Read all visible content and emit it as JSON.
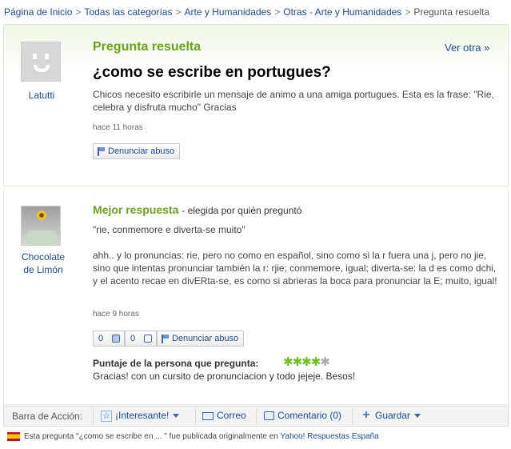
{
  "breadcrumb": {
    "items": [
      "Página de Inicio",
      "Todas las categorías",
      "Arte y Humanidades",
      "Otras - Arte y Humanidades"
    ],
    "separator": ">",
    "current": "Pregunta resuelta"
  },
  "question": {
    "status": "Pregunta resuelta",
    "ver_otra": "Ver otra »",
    "title": "¿como se escribe en portugues?",
    "body": "Chicos necesito escribirle un mensaje de animo a una amiga portugues. Esta es la frase: \"Rie, celebra y disfruta mucho\" Gracias",
    "time": "hace 11 horas",
    "report_label": "Denunciar abuso",
    "user": "Latutti"
  },
  "answer": {
    "title": "Mejor respuesta",
    "chosen_by": "- elegida por quién preguntó",
    "quote": "\"rie, conmemore e diverta-se muito\"",
    "body": "ahh.. y lo pronuncias: rie, pero no como en español, sino como si la r fuera una j, pero no jie, sino que intentas pronunciar también la r: rjie; conmemore, igual; diverta-se: la d es como dchi, y el acento recae en divERta-se, es como si abrieras la boca para pronunciar la E; muito, igual!",
    "time": "hace 9 horas",
    "thumbs_up": "0",
    "thumbs_down": "0",
    "report_label": "Denunciar abuso",
    "user_line1": "Chocolate",
    "user_line2": "de Limón"
  },
  "rating": {
    "label": "Puntaje de la persona que pregunta:",
    "stars": 4,
    "max": 5,
    "comment": "Gracias! con un cursito de pronunciacion y todo jejeje. Besos!"
  },
  "action_bar": {
    "label": "Barra de Acción:",
    "interesante": "¡Interesante!",
    "correo": "Correo",
    "comentario": "Comentario (0)",
    "guardar": "Guardar"
  },
  "footer": {
    "prefix": "Esta pregunta \"¿como se escribe en ... \" fue publicada originalmente en",
    "link": "Yahoo! Respuestas España"
  },
  "colors": {
    "accent_green": "#6aa31d",
    "link_blue": "#1a4c8e",
    "star_green": "#6bc21a"
  }
}
